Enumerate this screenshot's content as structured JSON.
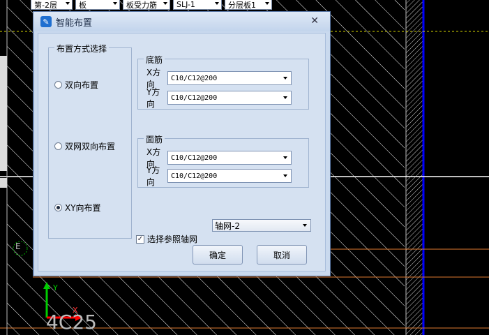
{
  "toolbar": {
    "floor": "第-2层",
    "component": "板",
    "rebar_type": "板受力筋",
    "spec": "SLJ-1",
    "layer": "分层板1"
  },
  "dialog": {
    "title": "智能布置",
    "layout_mode": {
      "legend": "布置方式选择",
      "options": [
        "双向布置",
        "双网双向布置",
        "XY向布置"
      ],
      "selected": "XY向布置"
    },
    "bottom_rebar": {
      "legend": "底筋",
      "x_label": "X方向",
      "x_value": "C10/C12@200",
      "y_label": "Y方向",
      "y_value": "C10/C12@200"
    },
    "top_rebar": {
      "legend": "面筋",
      "x_label": "X方向",
      "x_value": "C10/C12@200",
      "y_label": "Y方向",
      "y_value": "C10/C12@200"
    },
    "ref_axis": {
      "label": "选择参照轴网",
      "checked": true,
      "value": "轴网-2"
    },
    "ok_label": "确定",
    "cancel_label": "取消"
  },
  "canvas": {
    "grid_label": "E",
    "dimension_text": "4C25",
    "axis_y": "Y",
    "axis_x": "X"
  },
  "colors": {
    "dialog_bg": "#d5e1f1",
    "hatch": "#ffffff",
    "blue_line": "#0000ff",
    "orange_line": "#e07a30",
    "green_axis": "#00cc00",
    "red_axis": "#ff0000"
  }
}
